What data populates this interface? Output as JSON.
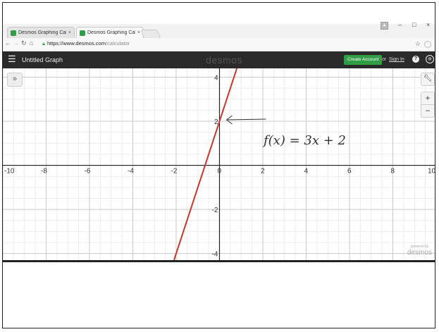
{
  "browser": {
    "tabs": [
      {
        "title": "Desmos Graphing Calcu"
      },
      {
        "title": "Desmos Graphing Calcu"
      }
    ],
    "tab_close_glyph": "×",
    "url_host": "https://www.desmos.com",
    "url_path": "/calculator",
    "window_controls": {
      "minimize": "–",
      "maximize": "□",
      "close": "×"
    }
  },
  "app": {
    "graph_title": "Untitled Graph",
    "logo": "desmos",
    "create_account_label": "Create Account",
    "or_text": "or",
    "sign_in_label": "Sign In",
    "help_glyph": "?",
    "accent_color": "#2f9e44"
  },
  "graph": {
    "x_tick_labels": [
      "-10",
      "-8",
      "-6",
      "-4",
      "-2",
      "0",
      "2",
      "4",
      "6",
      "8",
      "10"
    ],
    "y_tick_labels": [
      "4",
      "2",
      "-2",
      "-4"
    ],
    "x_ticks": [
      -10,
      -8,
      -6,
      -4,
      -2,
      0,
      2,
      4,
      6,
      8,
      10
    ],
    "y_ticks": [
      4,
      2,
      -2,
      -4
    ],
    "xlim": [
      -10,
      10
    ],
    "ylim": [
      -4.3,
      4.4
    ],
    "function": {
      "slope": 3,
      "intercept": 2,
      "color": "#c0392b"
    },
    "annotation": "f(x) = 3x + 2",
    "powered_by_small": "powered by",
    "powered_by_logo": "desmos"
  },
  "controls": {
    "expand_glyph": "»",
    "settings_icon": "wrench-icon",
    "zoom_in": "+",
    "zoom_out": "−"
  }
}
